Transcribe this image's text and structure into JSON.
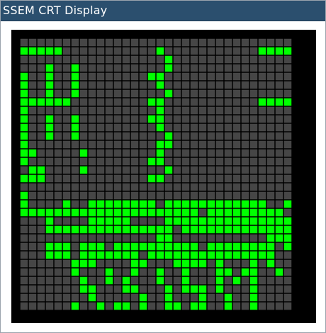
{
  "window": {
    "title": "SSEM CRT Display"
  },
  "crt": {
    "colors": {
      "on": "#00ff00",
      "off": "#464646",
      "grid": "#000000",
      "frame": "#000000"
    },
    "rows": [
      "................................",
      "#####...........#...........####",
      ".................#..............",
      "...#..#..........#..............",
      "#..#..#........##...............",
      "#..#..#.........#...............",
      "#..#..#..........#..............",
      "######.........##...........####",
      "#...............#...............",
      "#..#..#........##...............",
      "#..#..#.........#...............",
      "#..#..#..........#..............",
      "#...............##..............",
      "##.....#........#...............",
      "#..............##...............",
      ".##....#.........#..............",
      "###............##...............",
      "................................",
      "#...............................",
      "#....#..########.############..#",
      "#####################.#########.",
      "...#....#####....###############",
      "...###############.#############",
      "................##...........###",
      "...###.###.##########.########.#",
      "...###.#######.###############..",
      "......###....##...####.#...#.#..",
      "......#...#..#..#..#...##.##..#.",
      ".......#..#.#...#..#...#.#.#....",
      ".......##...##...#.###.#...#....",
      "........#.....#..#...#..#..#....",
      "......#..#.##.#..##.##..#..#...."
    ]
  }
}
